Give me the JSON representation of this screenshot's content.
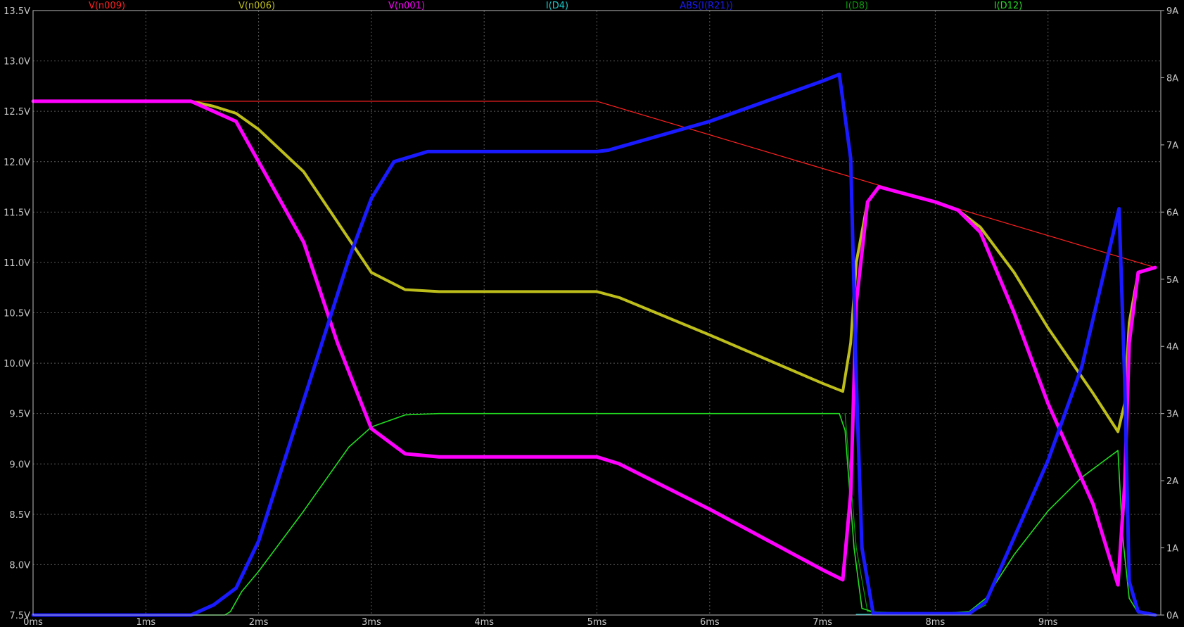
{
  "chart_data": {
    "type": "line",
    "title": "",
    "xlabel": "",
    "ylabel": "",
    "background": "#000000",
    "grid": true,
    "x_unit": "ms",
    "xlim": [
      0,
      10
    ],
    "ylim_left": [
      7.5,
      13.5
    ],
    "ylim_right": [
      0,
      9
    ],
    "x_ticks": [
      "0ms",
      "1ms",
      "2ms",
      "3ms",
      "4ms",
      "5ms",
      "6ms",
      "7ms",
      "8ms",
      "9ms"
    ],
    "y_ticks_left": [
      "13.5V",
      "13.0V",
      "12.5V",
      "12.0V",
      "11.5V",
      "11.0V",
      "10.5V",
      "10.0V",
      "9.5V",
      "9.0V",
      "8.5V",
      "8.0V",
      "7.5V"
    ],
    "y_ticks_right": [
      "9A",
      "8A",
      "7A",
      "6A",
      "5A",
      "4A",
      "3A",
      "2A",
      "1A",
      "0A"
    ],
    "series": [
      {
        "name": "V(n009)",
        "axis": "left",
        "color": "#ff2020",
        "width": 1.2,
        "x": [
          0,
          5,
          9.95
        ],
        "y": [
          12.6,
          12.6,
          10.95
        ]
      },
      {
        "name": "V(n006)",
        "axis": "left",
        "color": "#bdbd1c",
        "width": 4,
        "x": [
          0,
          1.4,
          1.6,
          1.8,
          2.0,
          2.4,
          2.7,
          3.0,
          3.3,
          3.6,
          4.0,
          4.5,
          5.0,
          5.2,
          6.0,
          7.0,
          7.18,
          7.25,
          7.3,
          7.4,
          7.5,
          8.0,
          8.2,
          8.4,
          8.7,
          9.0,
          9.4,
          9.62,
          9.68,
          9.72,
          9.8,
          9.95
        ],
        "y": [
          12.6,
          12.6,
          12.55,
          12.48,
          12.32,
          11.9,
          11.4,
          10.9,
          10.73,
          10.71,
          10.71,
          10.71,
          10.71,
          10.65,
          10.28,
          9.8,
          9.72,
          10.2,
          11.0,
          11.6,
          11.75,
          11.6,
          11.52,
          11.35,
          10.9,
          10.35,
          9.7,
          9.32,
          9.6,
          10.4,
          10.9,
          10.95
        ]
      },
      {
        "name": "V(n001)",
        "axis": "left",
        "color": "#ff00ff",
        "width": 5,
        "x": [
          0,
          1.4,
          1.6,
          1.8,
          2.0,
          2.4,
          2.7,
          3.0,
          3.3,
          3.6,
          4.0,
          5.0,
          5.2,
          6.0,
          7.0,
          7.18,
          7.25,
          7.3,
          7.4,
          7.5,
          8.0,
          8.2,
          8.4,
          8.7,
          9.0,
          9.4,
          9.62,
          9.68,
          9.72,
          9.8,
          9.95
        ],
        "y": [
          12.6,
          12.6,
          12.5,
          12.4,
          12.0,
          11.2,
          10.2,
          9.35,
          9.1,
          9.07,
          9.07,
          9.07,
          9.0,
          8.55,
          7.95,
          7.85,
          8.7,
          10.6,
          11.6,
          11.75,
          11.6,
          11.52,
          11.3,
          10.5,
          9.6,
          8.6,
          7.8,
          8.8,
          10.2,
          10.9,
          10.95
        ]
      },
      {
        "name": "I(D4)",
        "axis": "right",
        "color": "#19c8c8",
        "width": 1.2,
        "x": [
          7.3,
          7.5,
          8.0,
          8.3
        ],
        "y": [
          0.01,
          0.01,
          0.01,
          0.01
        ]
      },
      {
        "name": "ABS(I(R21))",
        "axis": "right",
        "color": "#1a1aff",
        "width": 5,
        "x": [
          0,
          1.4,
          1.6,
          1.8,
          2.0,
          2.4,
          2.8,
          3.0,
          3.2,
          3.5,
          4.0,
          4.5,
          5.0,
          5.1,
          6.0,
          7.0,
          7.15,
          7.25,
          7.3,
          7.35,
          7.45,
          8.0,
          8.3,
          8.45,
          9.0,
          9.3,
          9.63,
          9.68,
          9.72,
          9.8,
          9.95
        ],
        "y": [
          0,
          0,
          0.15,
          0.4,
          1.1,
          3.2,
          5.3,
          6.2,
          6.75,
          6.9,
          6.9,
          6.9,
          6.9,
          6.92,
          7.35,
          7.95,
          8.05,
          6.8,
          3.5,
          1.0,
          0.02,
          0.02,
          0.02,
          0.2,
          2.3,
          3.7,
          6.05,
          3.5,
          0.5,
          0.05,
          0
        ]
      },
      {
        "name": "I(D8)",
        "axis": "right",
        "color": "#0d9a0d",
        "width": 1.2,
        "x": [
          7.2,
          7.3,
          7.4,
          8.0,
          8.3,
          8.45
        ],
        "y": [
          3.0,
          1.0,
          0.05,
          0.02,
          0.02,
          0.15
        ]
      },
      {
        "name": "I(D12)",
        "axis": "right",
        "color": "#22dd22",
        "width": 1.6,
        "x": [
          0,
          1.7,
          1.75,
          1.85,
          2.0,
          2.4,
          2.8,
          3.0,
          3.3,
          3.6,
          4.0,
          5.0,
          6.0,
          7.0,
          7.15,
          7.2,
          7.28,
          7.35,
          7.5,
          8.0,
          8.3,
          8.45,
          8.7,
          9.0,
          9.3,
          9.5,
          9.62,
          9.66,
          9.72,
          9.8,
          9.95
        ],
        "y": [
          0,
          0,
          0.05,
          0.35,
          0.65,
          1.55,
          2.5,
          2.8,
          2.98,
          3.0,
          3.0,
          3.0,
          3.0,
          3.0,
          3.0,
          2.75,
          1.0,
          0.1,
          0.02,
          0.02,
          0.05,
          0.25,
          0.9,
          1.55,
          2.05,
          2.3,
          2.45,
          1.2,
          0.25,
          0.03,
          0
        ]
      }
    ]
  }
}
